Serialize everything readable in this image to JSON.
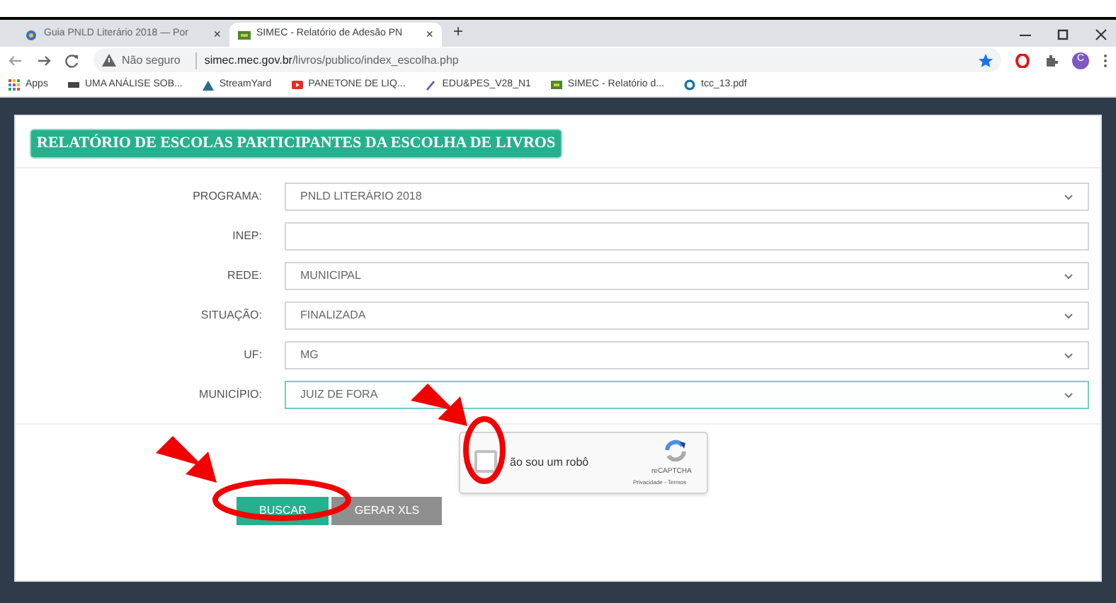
{
  "browser": {
    "tabs": [
      {
        "title": "Guia PNLD Literário 2018 — Por",
        "selected": false,
        "close": "×"
      },
      {
        "title": "SIMEC - Relatório de Adesão PN",
        "selected": true,
        "close": "×"
      }
    ],
    "new_tab": "+",
    "address": {
      "security": "Não seguro",
      "host": "simec.mec.gov.br",
      "path": "/livros/publico/index_escolha.php"
    },
    "profile": "C",
    "bookmarks": [
      {
        "label": "Apps"
      },
      {
        "label": "UMA ANÁLISE SOB..."
      },
      {
        "label": "StreamYard"
      },
      {
        "label": "PANETONE DE LIQ..."
      },
      {
        "label": "EDU&PES_V28_N1"
      },
      {
        "label": "SIMEC - Relatório d..."
      },
      {
        "label": "tcc_13.pdf"
      }
    ]
  },
  "page": {
    "title": "RELATÓRIO DE ESCOLAS PARTICIPANTES DA ESCOLHA DE LIVROS",
    "fields": [
      {
        "label": "PROGRAMA:",
        "kind": "select",
        "value": "PNLD LITERÁRIO 2018",
        "focused": false
      },
      {
        "label": "INEP:",
        "kind": "text",
        "focused": false
      },
      {
        "label": "REDE:",
        "kind": "select",
        "value": "MUNICIPAL",
        "focused": false
      },
      {
        "label": "SITUAÇÃO:",
        "kind": "select",
        "value": "FINALIZADA",
        "focused": false
      },
      {
        "label": "UF:",
        "kind": "select",
        "value": "MG",
        "focused": false
      },
      {
        "label": "MUNICÍPIO:",
        "kind": "select",
        "value": "JUIZ DE FORA",
        "focused": true
      }
    ],
    "captcha": {
      "label": "ão sou um robô",
      "checked": false,
      "brand": "reCAPTCHA",
      "links": "Privacidade - Termos"
    },
    "buttons": [
      {
        "label": "BUSCAR",
        "disabled": false
      },
      {
        "label": "GERAR XLS",
        "disabled": true
      }
    ]
  }
}
